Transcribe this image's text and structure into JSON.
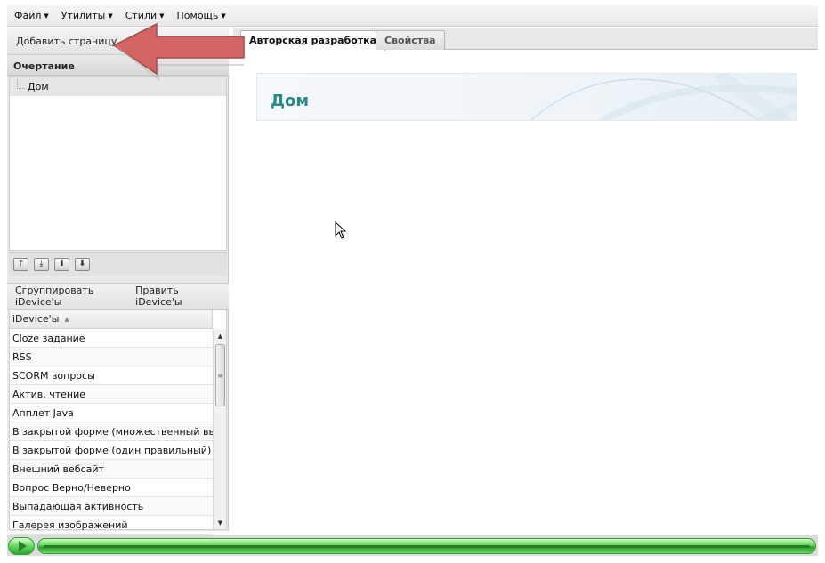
{
  "menubar": {
    "items": [
      {
        "label": "Файл"
      },
      {
        "label": "Утилиты"
      },
      {
        "label": "Стили"
      },
      {
        "label": "Помощь"
      }
    ]
  },
  "left_panel": {
    "add_page_label": "Добавить страницу",
    "outline_title": "Очертание",
    "outline_nodes": [
      {
        "label": "Дом"
      }
    ],
    "outline_tools": [
      "move-top-icon",
      "move-bottom-icon",
      "move-up-icon",
      "move-down-icon"
    ],
    "group_idevices_label": "Сгруппировать iDevice'ы",
    "edit_idevices_label": "Править iDevice'ы",
    "idevice_column_header": "iDevice'ы",
    "idevices": [
      "Cloze задание",
      "RSS",
      "SCORM вопросы",
      "Актив. чтение",
      "Апплет Java",
      "В закрытой форме (множественный выб…",
      "В закрытой форме (один правильный)",
      "Внешний вебсайт",
      "Вопрос Верно/Неверно",
      "Выпадающая активность",
      "Галерея изображений"
    ]
  },
  "main": {
    "tabs": [
      {
        "label": "Авторская разработка",
        "active": true
      },
      {
        "label": "Свойства",
        "active": false
      }
    ],
    "page_title": "Дом"
  },
  "bottom_bar": {
    "progress": 1.0
  },
  "colors": {
    "title": "#2a8a8a",
    "arrow": "#d25a5a",
    "progress_green": "#5ed654"
  }
}
